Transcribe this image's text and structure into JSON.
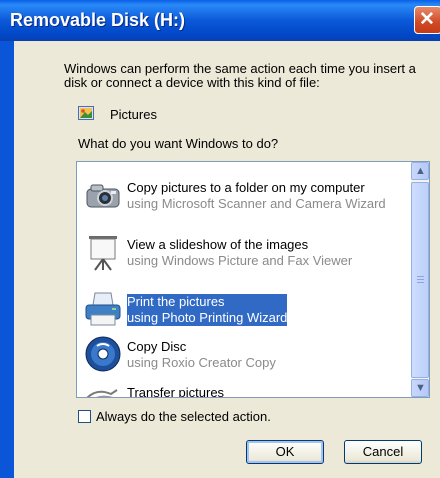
{
  "window": {
    "title": "Removable Disk (H:)",
    "close_glyph": "✕"
  },
  "intro_text": "Windows can perform the same action each time you insert a disk or connect a device with this kind of file:",
  "content_type": {
    "label": "Pictures",
    "icon": "pictures-icon"
  },
  "question": "What do you want Windows to do?",
  "actions": [
    {
      "title": "Copy pictures to a folder on my computer",
      "subtitle": "using Microsoft Scanner and Camera Wizard",
      "icon": "camera-icon",
      "selected": false
    },
    {
      "title": "View a slideshow of the images",
      "subtitle": "using Windows Picture and Fax Viewer",
      "icon": "projector-screen-icon",
      "selected": false
    },
    {
      "title": "Print the pictures",
      "subtitle": "using Photo Printing Wizard",
      "icon": "printer-icon",
      "selected": true
    },
    {
      "title": "Copy Disc",
      "subtitle": "using Roxio Creator Copy",
      "icon": "disc-icon",
      "selected": false
    },
    {
      "title": "Transfer pictures",
      "subtitle": "",
      "icon": "transfer-icon",
      "selected": false
    }
  ],
  "always_checkbox": {
    "label": "Always do the selected action.",
    "checked": false
  },
  "buttons": {
    "ok": "OK",
    "cancel": "Cancel"
  },
  "colors": {
    "titlebar": "#0b58d8",
    "selection": "#316ac5",
    "dialog_bg": "#ece9d8"
  }
}
